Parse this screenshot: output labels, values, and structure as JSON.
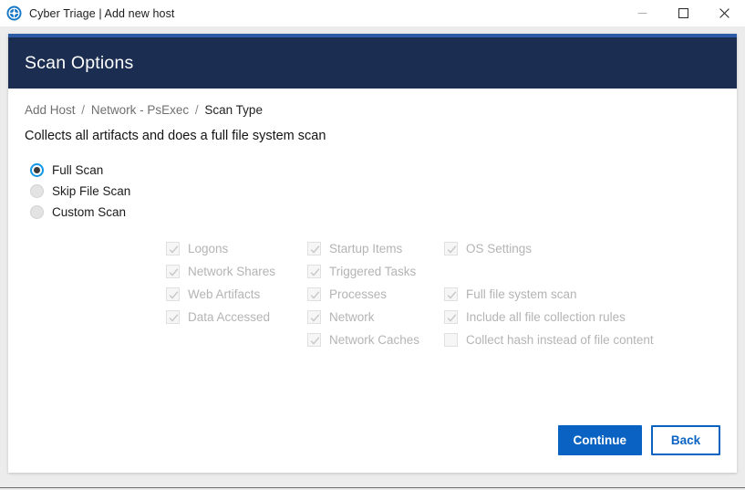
{
  "window": {
    "title": "Cyber Triage | Add new host",
    "logo_icon": "cyber-triage-logo-icon",
    "controls": {
      "minimize": "minimize-icon",
      "maximize": "maximize-icon",
      "close": "close-icon"
    }
  },
  "banner": {
    "title": "Scan Options",
    "background": "#1b2d51",
    "accent": "#2b5ca5"
  },
  "breadcrumb": {
    "items": [
      {
        "label": "Add Host",
        "current": false
      },
      {
        "label": "Network - PsExec",
        "current": false
      },
      {
        "label": "Scan Type",
        "current": true
      }
    ],
    "separator": "/"
  },
  "description": "Collects all artifacts and does a full file system scan",
  "scan_type": {
    "selected": "Full Scan",
    "options": [
      {
        "label": "Full Scan",
        "selected": true
      },
      {
        "label": "Skip File Scan",
        "selected": false
      },
      {
        "label": "Custom Scan",
        "selected": false
      }
    ]
  },
  "artifact_columns": [
    {
      "name": "column-1",
      "items": [
        {
          "label": "Logons",
          "checked": true,
          "disabled": true
        },
        {
          "label": "Network Shares",
          "checked": true,
          "disabled": true
        },
        {
          "label": "Web Artifacts",
          "checked": true,
          "disabled": true
        },
        {
          "label": "Data Accessed",
          "checked": true,
          "disabled": true
        }
      ]
    },
    {
      "name": "column-2",
      "items": [
        {
          "label": "Startup Items",
          "checked": true,
          "disabled": true
        },
        {
          "label": "Triggered Tasks",
          "checked": true,
          "disabled": true
        },
        {
          "label": "Processes",
          "checked": true,
          "disabled": true
        },
        {
          "label": "Network",
          "checked": true,
          "disabled": true
        },
        {
          "label": "Network Caches",
          "checked": true,
          "disabled": true
        }
      ]
    },
    {
      "name": "column-3",
      "items": [
        {
          "label": "OS Settings",
          "checked": true,
          "disabled": true
        },
        {
          "label": "",
          "checked": false,
          "disabled": true,
          "spacer": true
        },
        {
          "label": "Full file system scan",
          "checked": true,
          "disabled": true
        },
        {
          "label": "Include all file collection rules",
          "checked": true,
          "disabled": true
        },
        {
          "label": "Collect hash instead of file content",
          "checked": false,
          "disabled": true
        }
      ]
    }
  ],
  "footer": {
    "continue_label": "Continue",
    "back_label": "Back",
    "primary_color": "#0a63c2"
  }
}
